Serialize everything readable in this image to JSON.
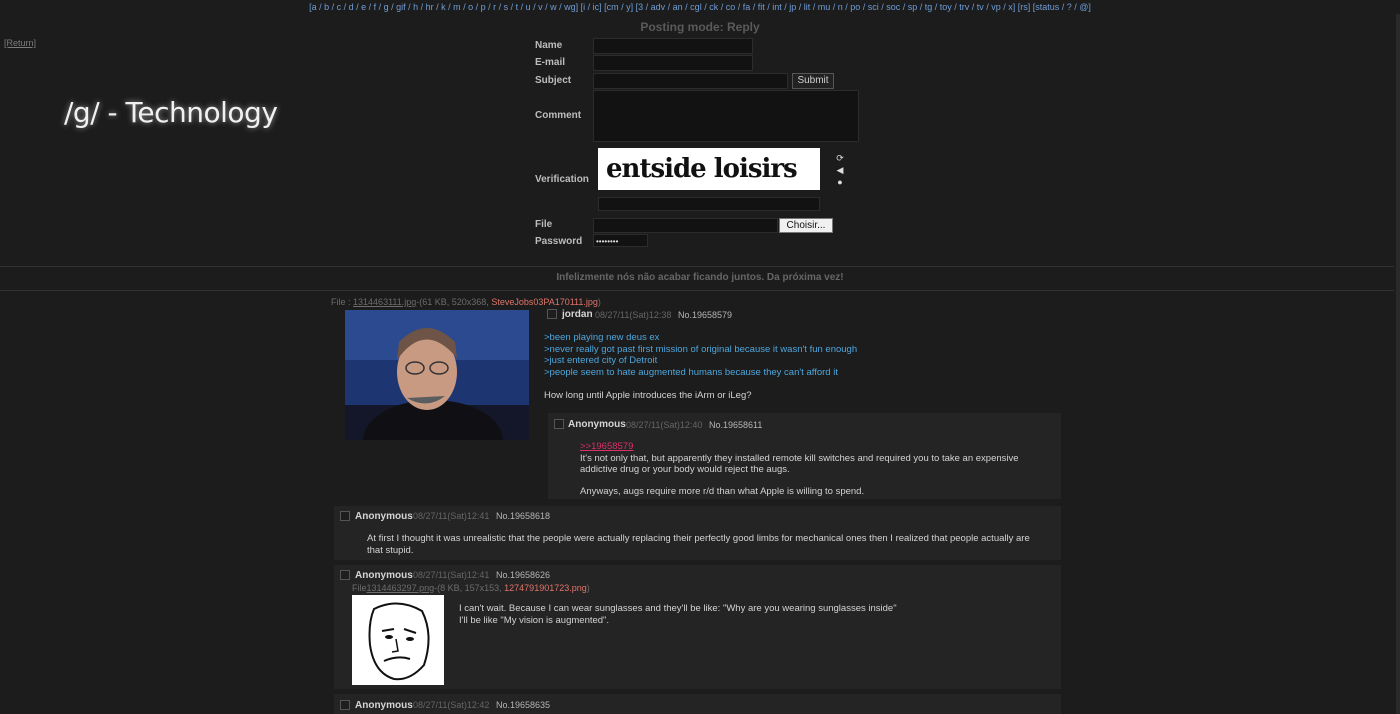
{
  "topbar": {
    "text": "[a / b / c / d / e / f / g / gif / h / hr / k / m / o / p / r / s / t / u / v / w / wg] [i / ic] [cm / y] [3 / adv / an / cgl / ck / co / fa / fit / int / jp / lit / mu / n / po / sci / soc / sp / tg / toy / trv / tv / vp / x] [rs] [status / ? / @]"
  },
  "return_link": "[Return]",
  "board_title": "/g/ - Technology",
  "form": {
    "mode_label": "Posting mode: Reply",
    "name_label": "Name",
    "email_label": "E-mail",
    "subject_label": "Subject",
    "submit_label": "Submit",
    "comment_label": "Comment",
    "verification_label": "Verification",
    "captcha_text": "entside loisirs",
    "file_label": "File",
    "choose_label": "Choisir...",
    "password_label": "Password",
    "password_value": "••••••••"
  },
  "announcement": "Infelizmente nós não acabar ficando juntos. Da próxima vez!",
  "op": {
    "file_prefix": "File :",
    "file_name": "1314463111.jpg",
    "file_meta": "-(61 KB, 520x368,",
    "file_orig": "SteveJobs03PA170111.jpg",
    "file_suffix": ")",
    "name": "jordan",
    "date": "08/27/11(Sat)12:38",
    "no": "No.19658579",
    "greentext": [
      ">been playing new deus ex",
      ">never really got past first mission of original because it wasn't fun enough",
      ">just entered city of Detroit",
      ">people seem to hate augmented humans because they can't afford it"
    ],
    "comment": "How long until Apple introduces the iArm or iLeg?"
  },
  "replies": [
    {
      "name": "Anonymous",
      "date": "08/27/11(Sat)12:40",
      "no": "No.19658611",
      "quote": ">>19658579",
      "lines": [
        "It's not only that, but apparently they installed remote kill switches and required you to take an expensive",
        "addictive drug or your body would reject the augs."
      ],
      "line2": "Anyways, augs require more r/d than what Apple is willing to spend."
    },
    {
      "name": "Anonymous",
      "date": "08/27/11(Sat)12:41",
      "no": "No.19658618",
      "lines": [
        "At first I thought it was unrealistic that the people were actually replacing their perfectly good limbs for mechanical ones then I realized that people actually are",
        "that stupid."
      ]
    },
    {
      "name": "Anonymous",
      "date": "08/27/11(Sat)12:41",
      "no": "No.19658626",
      "file_prefix": "File",
      "file_name": "1314463297.png",
      "file_meta": "-(8 KB, 157x153,",
      "file_orig": "1274791901723.png",
      "file_suffix": ")",
      "lines": [
        "I can't wait. Because I can wear sunglasses and they'll be like: \"Why are you wearing sunglasses inside\"",
        "I'll be like \"My vision is augmented\"."
      ]
    },
    {
      "name": "Anonymous",
      "date": "08/27/11(Sat)12:42",
      "no": "No.19658635"
    }
  ],
  "colors": {
    "background": "#1c1c1c",
    "reply_bg": "#242424",
    "greentext": "#4ea6dd",
    "quotelink": "#d9306b",
    "filename_orig": "#e0756a"
  }
}
